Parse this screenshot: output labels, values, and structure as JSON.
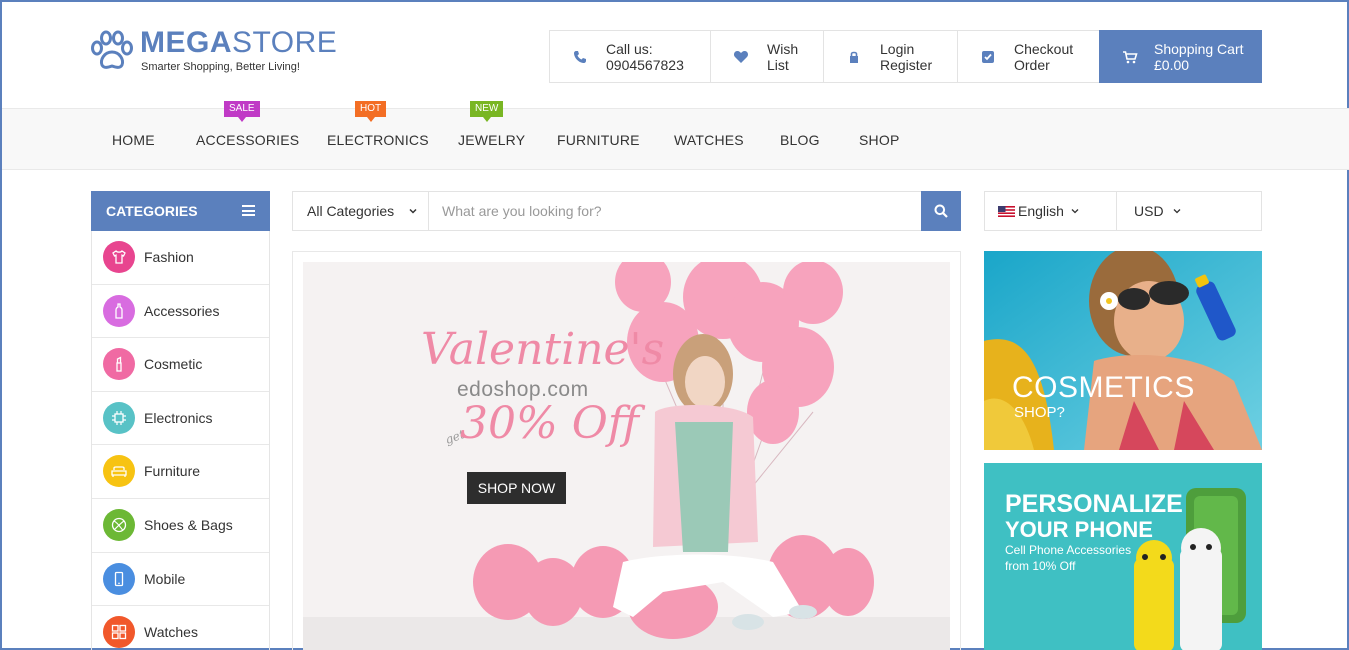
{
  "brand": {
    "name_bold": "MEGA",
    "name_light": "STORE",
    "tagline": "Smarter Shopping, Better Living!"
  },
  "header": {
    "call": {
      "line1": "Call us:",
      "line2": "0904567823"
    },
    "wish": {
      "line1": "Wish",
      "line2": "List"
    },
    "login": {
      "line1": "Login",
      "line2": "Register"
    },
    "checkout": {
      "line1": "Checkout",
      "line2": "Order"
    },
    "cart": {
      "line1": "Shopping Cart",
      "line2": "£0.00"
    }
  },
  "nav": {
    "items": [
      "HOME",
      "ACCESSORIES",
      "ELECTRONICS",
      "JEWELRY",
      "FURNITURE",
      "WATCHES",
      "BLOG",
      "SHOP"
    ],
    "badges": {
      "sale": "SALE",
      "hot": "HOT",
      "new": "NEW"
    }
  },
  "categories": {
    "title": "CATEGORIES",
    "items": [
      {
        "label": "Fashion",
        "icon": "tshirt-icon",
        "color": "#e8458f"
      },
      {
        "label": "Accessories",
        "icon": "bottle-icon",
        "color": "#d86ce0"
      },
      {
        "label": "Cosmetic",
        "icon": "lipstick-icon",
        "color": "#f06aa3"
      },
      {
        "label": "Electronics",
        "icon": "chip-icon",
        "color": "#58c2c6"
      },
      {
        "label": "Furniture",
        "icon": "sofa-icon",
        "color": "#f7c312"
      },
      {
        "label": "Shoes & Bags",
        "icon": "ball-icon",
        "color": "#6cb835"
      },
      {
        "label": "Mobile",
        "icon": "mobile-icon",
        "color": "#4a8ee0"
      },
      {
        "label": "Watches",
        "icon": "grid-icon",
        "color": "#f1582b"
      }
    ]
  },
  "search": {
    "category": "All Categories",
    "placeholder": "What are you looking for?"
  },
  "locale": {
    "language": "English",
    "currency": "USD"
  },
  "hero": {
    "title": "Valentine's",
    "site": "edoshop.com",
    "get": "get",
    "offer": "30% Off",
    "button": "SHOP NOW"
  },
  "promo1": {
    "title": "COSMETICS",
    "subtitle": "SHOP?"
  },
  "promo2": {
    "line1": "PERSONALIZE",
    "line2": "YOUR PHONE",
    "line3": "Cell Phone Accessories",
    "line4": "from 10% Off"
  },
  "colors": {
    "accent": "#5b80bd",
    "sale": "#c03ac6",
    "hot": "#f36e24",
    "new": "#79b623"
  }
}
